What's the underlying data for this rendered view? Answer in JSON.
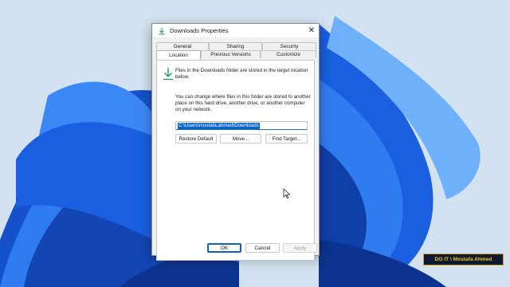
{
  "desktop": {
    "background_color": "#d3e2f1",
    "bloom_color": "#1a5fe0"
  },
  "window": {
    "title": "Downloads Properties",
    "icon": "download-arrow-icon",
    "close_glyph": "✕"
  },
  "tabs": [
    {
      "label": "General"
    },
    {
      "label": "Sharing"
    },
    {
      "label": "Security"
    },
    {
      "label": "Location",
      "active": true
    },
    {
      "label": "Previous Versions"
    },
    {
      "label": "Customize"
    }
  ],
  "location": {
    "intro_text": "Files in the Downloads folder are stored in the target location below.",
    "description": "You can change where files in this folder are stored to another place on this hard drive, another drive, or another computer on your network.",
    "path_value": "C:\\Users\\mostafa.ahmed\\Downloads",
    "restore_default_label": "Restore Default",
    "move_label": "Move...",
    "find_target_label": "Find Target..."
  },
  "footer": {
    "ok_label": "OK",
    "cancel_label": "Cancel",
    "apply_label": "Apply"
  },
  "watermark": {
    "text": "DO IT \\ Mostafa Ahmed"
  }
}
